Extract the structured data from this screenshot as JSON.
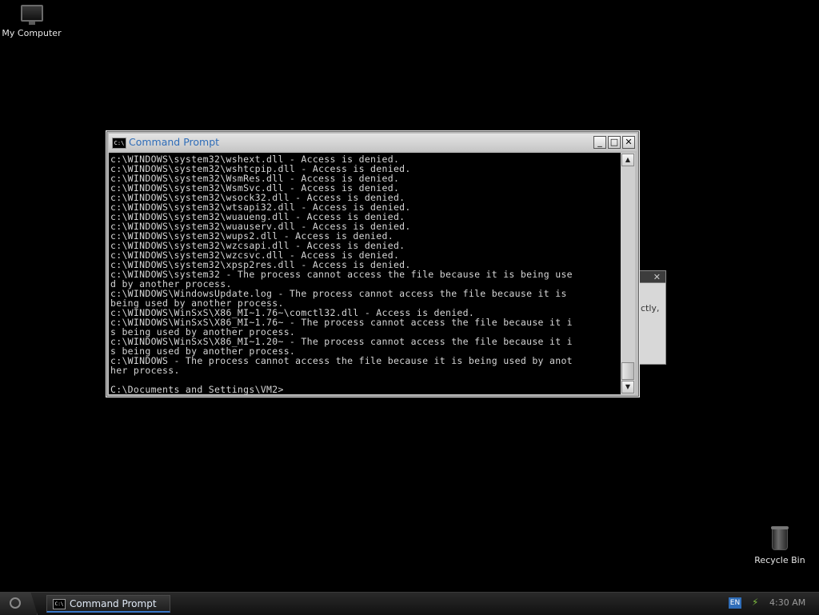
{
  "desktop": {
    "icons": [
      {
        "label": "My Computer",
        "icon": "monitor-icon"
      },
      {
        "label": "Recycle Bin",
        "icon": "trash-icon"
      }
    ]
  },
  "background_dialog": {
    "close_glyph": "✕",
    "partial_text": "ctly,"
  },
  "window": {
    "title": "Command Prompt",
    "icon_text": "C:\\",
    "controls": {
      "minimize": "_",
      "maximize": "□",
      "close": "✕"
    },
    "console_lines": [
      "c:\\WINDOWS\\system32\\wshext.dll - Access is denied.",
      "c:\\WINDOWS\\system32\\wshtcpip.dll - Access is denied.",
      "c:\\WINDOWS\\system32\\WsmRes.dll - Access is denied.",
      "c:\\WINDOWS\\system32\\WsmSvc.dll - Access is denied.",
      "c:\\WINDOWS\\system32\\wsock32.dll - Access is denied.",
      "c:\\WINDOWS\\system32\\wtsapi32.dll - Access is denied.",
      "c:\\WINDOWS\\system32\\wuaueng.dll - Access is denied.",
      "c:\\WINDOWS\\system32\\wuauserv.dll - Access is denied.",
      "c:\\WINDOWS\\system32\\wups2.dll - Access is denied.",
      "c:\\WINDOWS\\system32\\wzcsapi.dll - Access is denied.",
      "c:\\WINDOWS\\system32\\wzcsvc.dll - Access is denied.",
      "c:\\WINDOWS\\system32\\xpsp2res.dll - Access is denied.",
      "c:\\WINDOWS\\system32 - The process cannot access the file because it is being use",
      "d by another process.",
      "c:\\WINDOWS\\WindowsUpdate.log - The process cannot access the file because it is",
      "being used by another process.",
      "c:\\WINDOWS\\WinSxS\\X86_MI~1.76~\\comctl32.dll - Access is denied.",
      "c:\\WINDOWS\\WinSxS\\X86_MI~1.76~ - The process cannot access the file because it i",
      "s being used by another process.",
      "c:\\WINDOWS\\WinSxS\\X86_MI~1.20~ - The process cannot access the file because it i",
      "s being used by another process.",
      "c:\\WINDOWS - The process cannot access the file because it is being used by anot",
      "her process.",
      "",
      "C:\\Documents and Settings\\VM2>"
    ]
  },
  "taskbar": {
    "task_label": "Command Prompt",
    "task_icon_text": "C:\\",
    "tray": {
      "language": "EN",
      "clock": "4:30 AM"
    }
  },
  "colors": {
    "accent": "#2f6db8",
    "console_bg": "#000000",
    "console_fg": "#d6d6d6"
  }
}
